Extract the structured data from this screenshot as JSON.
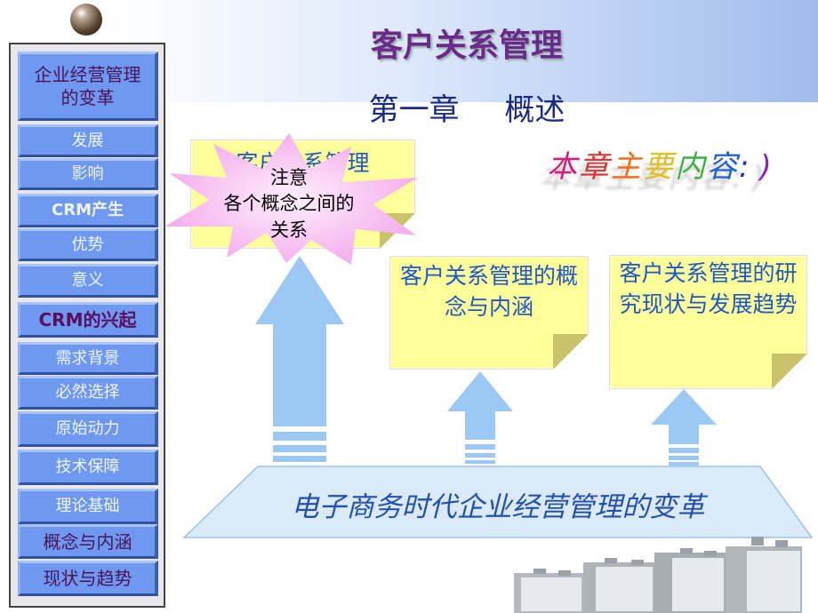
{
  "header": {
    "title": "客户关系管理",
    "subtitle": "第一章 概述"
  },
  "sidebar": {
    "items": [
      {
        "label": "企业经营管理的变革"
      },
      {
        "label": "发展"
      },
      {
        "label": "影响"
      },
      {
        "label": "CRM产生"
      },
      {
        "label": "优势"
      },
      {
        "label": "意义"
      },
      {
        "label": "CRM的兴起"
      },
      {
        "label": "需求背景"
      },
      {
        "label": "必然选择"
      },
      {
        "label": "原始动力"
      },
      {
        "label": "技术保障"
      },
      {
        "label": "理论基础"
      },
      {
        "label": "概念与内涵"
      },
      {
        "label": "现状与趋势"
      }
    ]
  },
  "main": {
    "rainbow_heading": [
      "本",
      "章",
      "主",
      "要",
      "内",
      "容",
      ":",
      ")"
    ],
    "rainbow_colors": [
      "#d0207a",
      "#e03030",
      "#f07020",
      "#e0c020",
      "#40b040",
      "#2060d0",
      "#2030d0",
      "#9020c0"
    ],
    "notes": [
      {
        "text": "客户关系管理"
      },
      {
        "text": "客户关系管理的概念与内涵"
      },
      {
        "text": "客户关系管理的研究现状与发展趋势"
      }
    ],
    "callout": {
      "line1": "注意",
      "line2": "各个概念之间的",
      "line3": "关系"
    },
    "base": "电子商务时代企业经营管理的变革"
  },
  "colors": {
    "button": "#6f98f0",
    "note": "#ffff99",
    "callout": "#f8c0f0",
    "arrow": "#9cc8f5",
    "title": "#6a2a8a"
  }
}
